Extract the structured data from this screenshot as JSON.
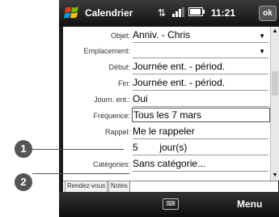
{
  "statusbar": {
    "app_title": "Calendrier",
    "clock": "11:21",
    "ok_label": "ok",
    "icons": [
      "connectivity-icon",
      "signal-icon",
      "battery-icon"
    ]
  },
  "form": {
    "objet": {
      "label": "Objet:",
      "value": "Anniv. - Chris"
    },
    "emplacement": {
      "label": "Emplacement:",
      "value": ""
    },
    "debut": {
      "label": "Début:",
      "value": "Journée ent. - périod."
    },
    "fin": {
      "label": "Fin:",
      "value": "Journée ent. - périod."
    },
    "journee_entiere": {
      "label": "Journ. ent.:",
      "value": "Oui"
    },
    "frequence": {
      "label": "Fréquence:",
      "value": "Tous les 7 mars"
    },
    "rappel": {
      "label": "Rappel:",
      "value": "Me le rappeler"
    },
    "rappel_delai": {
      "number": "5",
      "unit": "jour(s)"
    },
    "categories": {
      "label": "Catégories:",
      "value": "Sans catégorie..."
    }
  },
  "tabs": [
    "Rendez-vous",
    "Notes"
  ],
  "softbar": {
    "menu_label": "Menu"
  },
  "callouts": [
    "1",
    "2"
  ]
}
